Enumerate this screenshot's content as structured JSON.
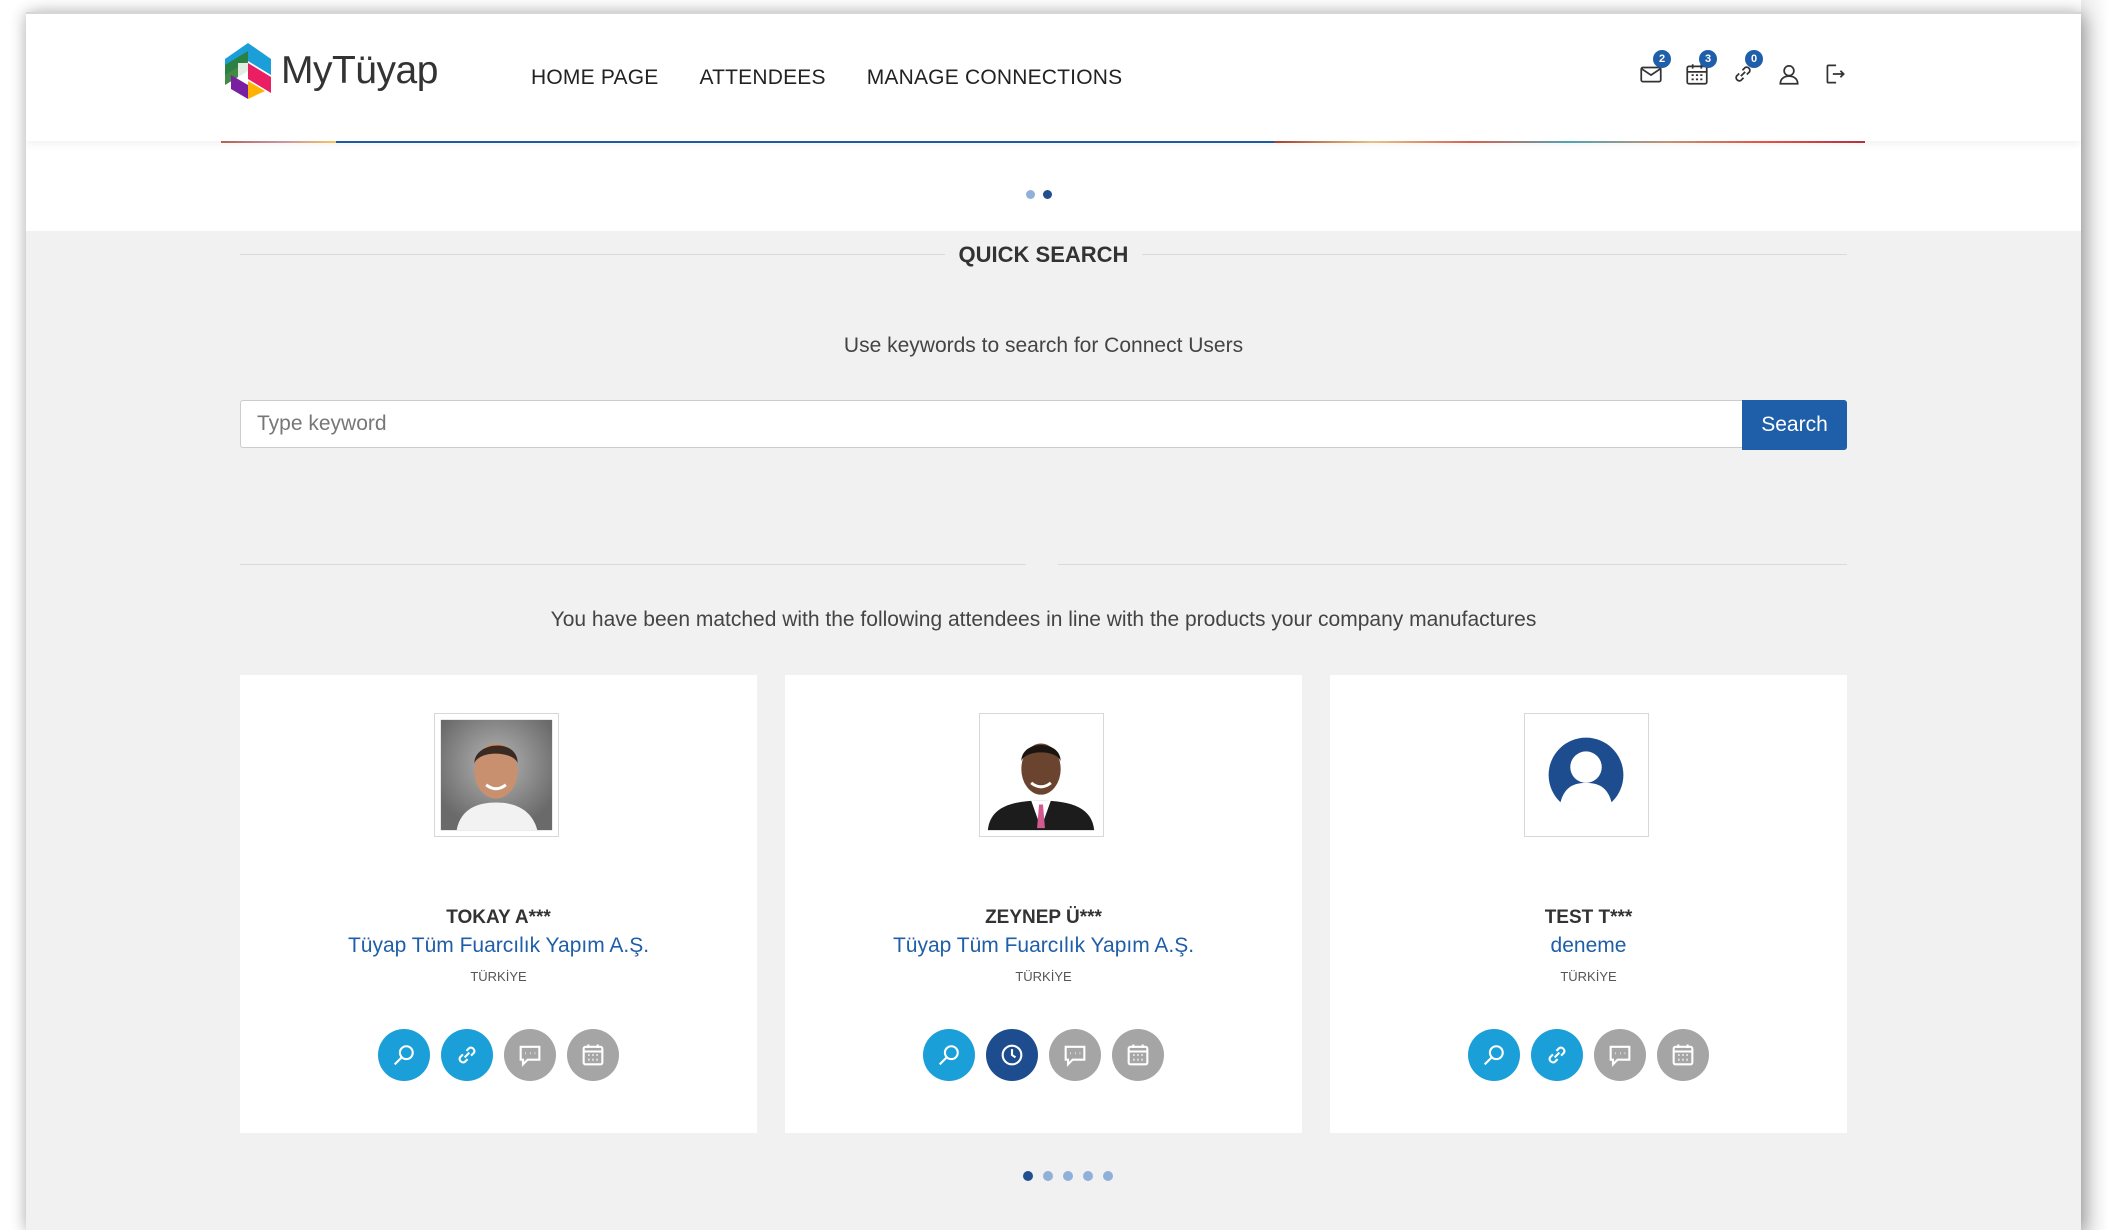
{
  "brand": {
    "name": "MyTüyap"
  },
  "nav": {
    "items": [
      "HOME PAGE",
      "ATTENDEES",
      "MANAGE CONNECTIONS"
    ]
  },
  "header_icons": {
    "messages_count": "2",
    "calendar_count": "3",
    "connections_count": "0"
  },
  "banner": {
    "slides": 2,
    "active": 2
  },
  "quick_search": {
    "title": "QUICK SEARCH",
    "subtitle": "Use keywords to search for Connect Users",
    "placeholder": "Type keyword",
    "value": "",
    "button": "Search"
  },
  "matches": {
    "intro": "You have been matched with the following attendees in line with the products your company manufactures",
    "cards": [
      {
        "name": "TOKAY A***",
        "company": "Tüyap Tüm Fuarcılık Yapım A.Ş.",
        "country": "TÜRKİYE",
        "connection_state": "link-icon"
      },
      {
        "name": "ZEYNEP Ü***",
        "company": "Tüyap Tüm Fuarcılık Yapım A.Ş.",
        "country": "TÜRKİYE",
        "connection_state": "clock-icon"
      },
      {
        "name": "TEST T***",
        "company": "deneme",
        "country": "TÜRKİYE",
        "connection_state": "link-icon"
      }
    ],
    "pages": 5,
    "active_page": 1
  },
  "colors": {
    "primary": "#1f5ea8",
    "accent": "#1b9fd8",
    "navy": "#1e4d8f",
    "grey": "#a5a5a5",
    "background": "#f1f1f1"
  }
}
